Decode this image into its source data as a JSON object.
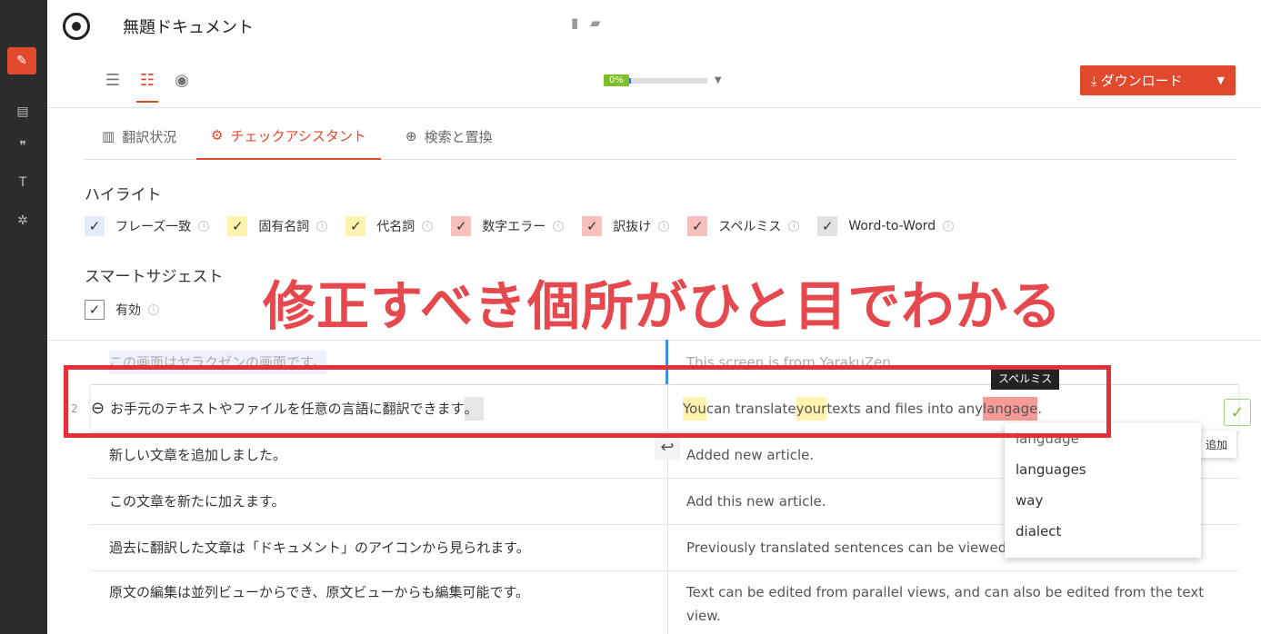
{
  "app": {
    "doc_title": "無題ドキュメント",
    "progress_label": "0%",
    "progress_value": 0.02,
    "download_label": "ダウンロード"
  },
  "tabs": [
    {
      "label": "翻訳状況"
    },
    {
      "label": "チェックアシスタント"
    },
    {
      "label": "検索と置換"
    }
  ],
  "highlight": {
    "title": "ハイライト",
    "items": [
      {
        "label": "フレーズ一致",
        "color": "#e4ecfb"
      },
      {
        "label": "固有名詞",
        "color": "#fff3b0"
      },
      {
        "label": "代名詞",
        "color": "#fff3b0"
      },
      {
        "label": "数字エラー",
        "color": "#f7c0bd"
      },
      {
        "label": "訳抜け",
        "color": "#f7c0bd"
      },
      {
        "label": "スペルミス",
        "color": "#f7c0bd"
      },
      {
        "label": "Word-to-Word",
        "color": "#e2e2e2"
      }
    ]
  },
  "smart_suggest": {
    "title": "スマートサジェスト",
    "enabled_label": "有効"
  },
  "banner": "修正すべき個所がひと目でわかる",
  "rows": [
    {
      "src": "この画面はヤラクゼンの画面です。",
      "tgt": "This screen is from YarakuZen."
    },
    {
      "src": "お手元のテキストやファイルを任意の言語に翻訳できます",
      "src_end": "。",
      "tgt_a": "You",
      "tgt_b": " can translate ",
      "tgt_c": "your",
      "tgt_d": " texts and files into any ",
      "tgt_e": "langage",
      "tgt_f": ".",
      "num": "2"
    },
    {
      "src": "新しい文章を追加しました。",
      "tgt": "Added new article."
    },
    {
      "src": "この文章を新たに加えます。",
      "tgt": "Add this new article."
    },
    {
      "src": "過去に翻訳した文章は「ドキュメント」のアイコンから見られます。",
      "tgt": "Previously translated sentences can be viewed"
    },
    {
      "src": "原文の編集は並列ビューからでき、原文ビューからも編集可能です。",
      "tgt": "Text can be edited from parallel views, and can also be edited from the text view."
    }
  ],
  "tooltip": "スペルミス",
  "suggestions": [
    "language",
    "languages",
    "way",
    "dialect"
  ],
  "add_label": "追加"
}
